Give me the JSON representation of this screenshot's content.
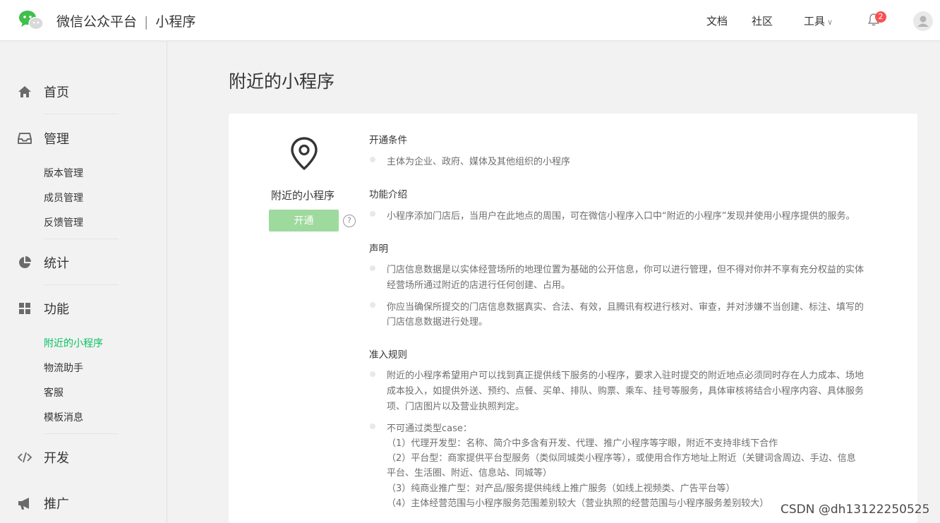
{
  "header": {
    "brand": "微信公众平台",
    "separator": "|",
    "product": "小程序",
    "nav": {
      "docs": "文档",
      "community": "社区",
      "tools": "工具"
    },
    "notification_count": "2"
  },
  "sidebar": {
    "home": "首页",
    "manage": "管理",
    "manage_items": [
      "版本管理",
      "成员管理",
      "反馈管理"
    ],
    "stats": "统计",
    "features": "功能",
    "feature_items": [
      "附近的小程序",
      "物流助手",
      "客服",
      "模板消息"
    ],
    "develop": "开发",
    "promote": "推广"
  },
  "main": {
    "page_title": "附近的小程序",
    "feature_name": "附近的小程序",
    "open_button": "开通",
    "help_icon": "?",
    "sections": {
      "conditions_title": "开通条件",
      "conditions_line": "主体为企业、政府、媒体及其他组织的小程序",
      "intro_title": "功能介绍",
      "intro_line": "小程序添加门店后，当用户在此地点的周围，可在微信小程序入口中“附近的小程序”发现并使用小程序提供的服务。",
      "statement_title": "声明",
      "statement_1a": "门店信息数据是以实体经营场所的地理位置为基础的公开信息，你可以进行管理，但不得对你并不享有充分权益的实体",
      "statement_1b": "经营场所通过附近的店进行任何创建、占用。",
      "statement_2a": "你应当确保所提交的门店信息数据真实、合法、有效，且腾讯有权进行核对、审查，并对涉嫌不当创建、标注、填写的",
      "statement_2b": "门店信息数据进行处理。",
      "rules_title": "准入规则",
      "rules_1a": "附近的小程序希望用户可以找到真正提供线下服务的小程序，要求入驻时提交的附近地点必须同时存在人力成本、场地",
      "rules_1b": "成本投入，如提供外送、预约、点餐、买单、排队、购票、乘车、挂号等服务，具体审核将结合小程序内容、具体服务",
      "rules_1c": "项、门店图片以及营业执照判定。",
      "rules_2_head": "不可通过类型case：",
      "rules_2_l1": "（1）代理开发型：名称、简介中多含有开发、代理、推广小程序等字眼，附近不支持非线下合作",
      "rules_2_l2a": "（2）平台型：商家提供平台型服务（类似同城类小程序等），或使用合作方地址上附近（关键词含周边、手边、信息",
      "rules_2_l2b": "平台、生活圈、附近、信息站、同城等）",
      "rules_2_l3": "（3）纯商业推广型：对产品/服务提供纯线上推广服务（如线上视频类、广告平台等）",
      "rules_2_l4": "（4）主体经营范围与小程序服务范围差别较大（营业执照的经营范围与小程序服务差别较大）"
    }
  },
  "watermark": "CSDN @dh13122250525",
  "colors": {
    "accent": "#07c160",
    "button_disabled": "#9ed99d",
    "badge": "#fa5151"
  }
}
